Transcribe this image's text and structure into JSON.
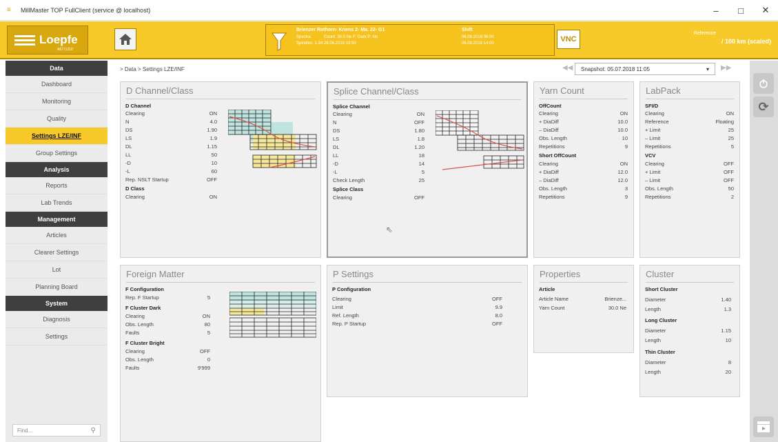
{
  "window": {
    "title": "MillMaster TOP FullClient (service @ localhost)",
    "min": "–",
    "max": "□",
    "close": "✕"
  },
  "header": {
    "logo": "Loepfe",
    "logo_sub": "A6771210",
    "lot": "Brienzer Rothorn- Kriens 2- Ma. 22- G1",
    "spectra": "Spectra",
    "spindles": "Spindles: 1-34",
    "count": "Count: 30.0 Ne F: Dark P: No",
    "lot_date": "28.06.2018 19:50",
    "shift_title": "Shift",
    "shift_from": "06.08.2018 06:00",
    "shift_to": "06.08.2018 14:00",
    "vnc": "VNC",
    "ref_label": "Reference",
    "ref_value": "/ 100 km (scaled)"
  },
  "sidebar": {
    "sections": [
      {
        "title": "Data",
        "items": [
          "Dashboard",
          "Monitoring",
          "Quality",
          "Settings LZE/INF",
          "Group Settings"
        ]
      },
      {
        "title": "Analysis",
        "items": [
          "Reports",
          "Lab Trends"
        ]
      },
      {
        "title": "Management",
        "items": [
          "Articles",
          "Clearer Settings",
          "Lot",
          "Planning Board"
        ]
      },
      {
        "title": "System",
        "items": [
          "Diagnosis",
          "Settings"
        ]
      }
    ],
    "active": "Settings LZE/INF",
    "find_placeholder": "Find..."
  },
  "breadcrumb": "> Data > Settings LZE/INF",
  "snapshot": "Snapshot: 05.07.2018 11:05",
  "panels": {
    "dchannel": {
      "title": "D Channel/Class",
      "h1": "D Channel",
      "rows": [
        [
          "Clearing",
          "ON"
        ],
        [
          "N",
          "4.0"
        ],
        [
          "DS",
          "1.90"
        ],
        [
          "LS",
          "1.9"
        ],
        [
          "DL",
          "1.15"
        ],
        [
          "LL",
          "50"
        ],
        [
          "-D",
          "10"
        ],
        [
          "-L",
          "60"
        ],
        [
          "Rep. NSLT Startup",
          "OFF"
        ]
      ],
      "h2": "D Class",
      "rows2": [
        [
          "Clearing",
          "ON"
        ]
      ]
    },
    "splice": {
      "title": "Splice Channel/Class",
      "h1": "Splice Channel",
      "rows": [
        [
          "Clearing",
          "ON"
        ],
        [
          "N",
          "OFF"
        ],
        [
          "DS",
          "1.80"
        ],
        [
          "LS",
          "1.8"
        ],
        [
          "DL",
          "1.20"
        ],
        [
          "LL",
          "18"
        ],
        [
          "-D",
          "14"
        ],
        [
          "-L",
          "5"
        ],
        [
          "Check Length",
          "25"
        ]
      ],
      "h2": "Splice Class",
      "rows2": [
        [
          "Clearing",
          "OFF"
        ]
      ]
    },
    "yarn": {
      "title": "Yarn Count",
      "h1": "OffCount",
      "rows": [
        [
          "Clearing",
          "ON"
        ],
        [
          "+ DiaDiff",
          "10.0"
        ],
        [
          "– DiaDiff",
          "10.0"
        ],
        [
          "Obs. Length",
          "10"
        ],
        [
          "Repetitions",
          "9"
        ]
      ],
      "h2": "Short OffCount",
      "rows2": [
        [
          "Clearing",
          "ON"
        ],
        [
          "+ DiaDiff",
          "12.0"
        ],
        [
          "– DiaDiff",
          "12.0"
        ],
        [
          "Obs. Length",
          "3"
        ],
        [
          "Repetitions",
          "9"
        ]
      ]
    },
    "labpack": {
      "title": "LabPack",
      "h1": "SFI/D",
      "rows": [
        [
          "Clearing",
          "ON"
        ],
        [
          "Reference",
          "Floating"
        ],
        [
          "+ Limit",
          "25"
        ],
        [
          "– Limit",
          "25"
        ],
        [
          "Repetitions",
          "5"
        ]
      ],
      "h2": "VCV",
      "rows2": [
        [
          "Clearing",
          "OFF"
        ],
        [
          "+ Limit",
          "OFF"
        ],
        [
          "– Limit",
          "OFF"
        ],
        [
          "Obs. Length",
          "50"
        ],
        [
          "Repetitions",
          "2"
        ]
      ]
    },
    "foreign": {
      "title": "Foreign Matter",
      "h1": "F Configuration",
      "rows": [
        [
          "Rep. F Startup",
          "5"
        ]
      ],
      "h2": "F Cluster Dark",
      "rows2": [
        [
          "Clearing",
          "ON"
        ],
        [
          "Obs. Length",
          "80"
        ],
        [
          "Faults",
          "5"
        ]
      ],
      "h3": "F Cluster Bright",
      "rows3": [
        [
          "Clearing",
          "OFF"
        ],
        [
          "Obs. Length",
          "0"
        ],
        [
          "Faults",
          "9'999"
        ]
      ]
    },
    "psettings": {
      "title": "P Settings",
      "h1": "P Configuration",
      "rows": [
        [
          "Clearing",
          "OFF"
        ],
        [
          "Limit",
          "9.9"
        ],
        [
          "Ref. Length",
          "8.0"
        ],
        [
          "Rep. P Startup",
          "OFF"
        ]
      ]
    },
    "properties": {
      "title": "Properties",
      "h1": "Article",
      "rows": [
        [
          "Article Name",
          "Brienze..."
        ],
        [
          "Yarn Count",
          "30.0 Ne"
        ]
      ]
    },
    "cluster": {
      "title": "Cluster",
      "h1": "Short Cluster",
      "rows": [
        [
          "Diameter",
          "1.40"
        ],
        [
          "Length",
          "1.3"
        ]
      ],
      "h2": "Long Cluster",
      "rows2": [
        [
          "Diameter",
          "1.15"
        ],
        [
          "Length",
          "10"
        ]
      ],
      "h3": "Thin Cluster",
      "rows3": [
        [
          "Diameter",
          "8"
        ],
        [
          "Length",
          "20"
        ]
      ]
    }
  },
  "colors": {
    "accent": "#f7ca2a",
    "dark": "#3f3f3f",
    "grid_teal": "#bfe3df",
    "grid_yellow": "#f6e79a",
    "curve": "#d8544a"
  }
}
